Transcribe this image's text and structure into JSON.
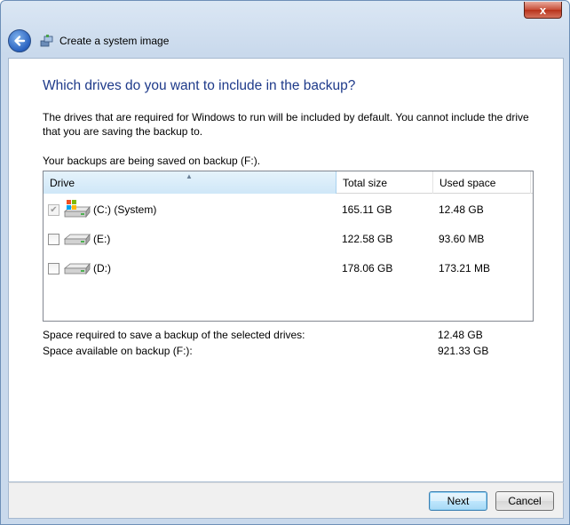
{
  "window": {
    "title": "Create a system image",
    "close_glyph": "x"
  },
  "page": {
    "heading": "Which drives do you want to include in the backup?",
    "description": "The drives that are required for Windows to run will be included by default. You cannot include the drive that you are saving the backup to.",
    "saving_on": "Your backups are being saved on backup (F:)."
  },
  "table": {
    "columns": [
      "Drive",
      "Total size",
      "Used space"
    ],
    "rows": [
      {
        "name": "(C:) (System)",
        "total": "165.11 GB",
        "used": "12.48 GB",
        "checked": true,
        "disabled": true,
        "icon": "system-drive-icon"
      },
      {
        "name": "(E:)",
        "total": "122.58 GB",
        "used": "93.60 MB",
        "checked": false,
        "disabled": false,
        "icon": "hard-drive-icon"
      },
      {
        "name": "(D:)",
        "total": "178.06 GB",
        "used": "173.21 MB",
        "checked": false,
        "disabled": false,
        "icon": "hard-drive-icon"
      }
    ]
  },
  "summary": {
    "required_label": "Space required to save a backup of the selected drives:",
    "required_value": "12.48 GB",
    "available_label": "Space available on backup (F:):",
    "available_value": "921.33 GB"
  },
  "buttons": {
    "next": "Next",
    "cancel": "Cancel"
  },
  "colors": {
    "heading": "#1e3a8a",
    "accent": "#2a62c0"
  }
}
